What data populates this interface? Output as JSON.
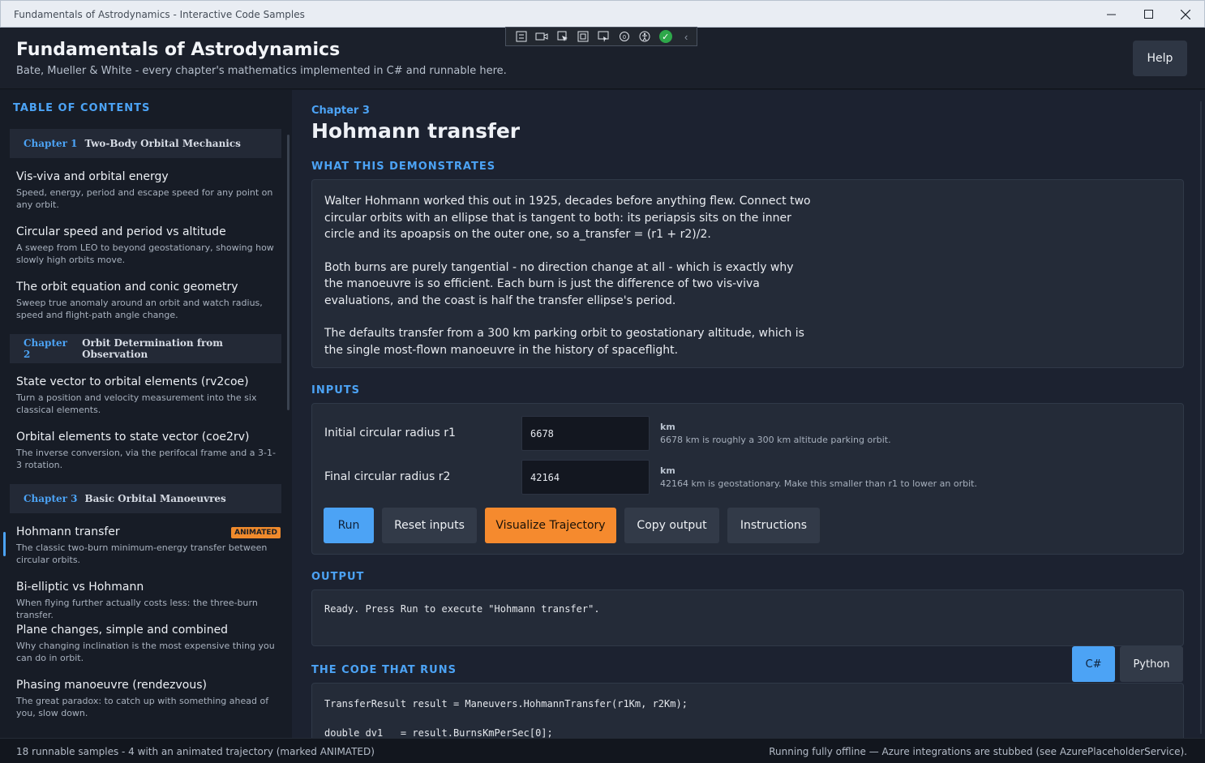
{
  "window": {
    "title": "Fundamentals of Astrodynamics - Interactive Code Samples"
  },
  "header": {
    "title": "Fundamentals of Astrodynamics",
    "subtitle": "Bate, Mueller & White - every chapter's mathematics implemented in C# and runnable here.",
    "help_label": "Help"
  },
  "sidebar": {
    "heading": "TABLE OF CONTENTS",
    "chapters": [
      {
        "num": "Chapter 1",
        "name": "Two-Body Orbital Mechanics"
      },
      {
        "num": "Chapter 2",
        "name": "Orbit Determination from Observation"
      },
      {
        "num": "Chapter 3",
        "name": "Basic Orbital Manoeuvres"
      }
    ],
    "items": [
      {
        "title": "Vis-viva and orbital energy",
        "desc": "Speed, energy, period and escape speed for any point on any orbit."
      },
      {
        "title": "Circular speed and period vs altitude",
        "desc": "A sweep from LEO to beyond geostationary, showing how slowly high orbits move."
      },
      {
        "title": "The orbit equation and conic geometry",
        "desc": "Sweep true anomaly around an orbit and watch radius, speed and flight-path angle change."
      },
      {
        "title": "State vector to orbital elements (rv2coe)",
        "desc": "Turn a position and velocity measurement into the six classical elements."
      },
      {
        "title": "Orbital elements to state vector (coe2rv)",
        "desc": "The inverse conversion, via the perifocal frame and a 3-1-3 rotation."
      },
      {
        "title": "Hohmann transfer",
        "desc": "The classic two-burn minimum-energy transfer between circular orbits.",
        "badge": "ANIMATED"
      },
      {
        "title": "Bi-elliptic vs Hohmann",
        "desc": "When flying further actually costs less: the three-burn transfer."
      },
      {
        "title": "Plane changes, simple and combined",
        "desc": "Why changing inclination is the most expensive thing you can do in orbit."
      },
      {
        "title": "Phasing manoeuvre (rendezvous)",
        "desc": "The great paradox: to catch up with something ahead of you, slow down."
      }
    ]
  },
  "main": {
    "chapter_label": "Chapter 3",
    "title": "Hohmann transfer",
    "section_demo": "WHAT THIS DEMONSTRATES",
    "demo_paragraphs": [
      "Walter Hohmann worked this out in 1925, decades before anything flew. Connect two circular orbits with an ellipse that is tangent to both: its periapsis sits on the inner circle and its apoapsis on the outer one, so a_transfer = (r1 + r2)/2.",
      "Both burns are purely tangential - no direction change at all - which is exactly why the manoeuvre is so efficient. Each burn is just the difference of two vis-viva evaluations, and the coast is half the transfer ellipse's period.",
      "The defaults transfer from a 300 km parking orbit to geostationary altitude, which is the single most-flown manoeuvre in the history of spaceflight."
    ],
    "section_inputs": "INPUTS",
    "inputs": [
      {
        "label": "Initial circular radius r1",
        "value": "6678",
        "unit": "km",
        "hint": "6678 km is roughly a 300 km altitude parking orbit."
      },
      {
        "label": "Final circular radius r2",
        "value": "42164",
        "unit": "km",
        "hint": "42164 km is geostationary. Make this smaller than r1 to lower an orbit."
      }
    ],
    "buttons": {
      "run": "Run",
      "reset": "Reset inputs",
      "visualize": "Visualize Trajectory",
      "copy": "Copy output",
      "instructions": "Instructions"
    },
    "section_output": "OUTPUT",
    "output_text": "Ready. Press Run to execute \"Hohmann transfer\".",
    "section_code": "THE CODE THAT RUNS",
    "lang_tabs": {
      "csharp": "C#",
      "python": "Python"
    },
    "code_lines": [
      "TransferResult result = Maneuvers.HohmannTransfer(r1Km, r2Km);",
      "",
      "double dv1   = result.BurnsKmPerSec[0];"
    ]
  },
  "status": {
    "left": "18 runnable samples  -  4 with an animated trajectory (marked ANIMATED)",
    "right": "Running fully offline — Azure integrations are stubbed (see AzurePlaceholderService)."
  },
  "colors": {
    "accent": "#4ca3f5",
    "orange": "#f58a2e",
    "background": "#1c2230"
  }
}
